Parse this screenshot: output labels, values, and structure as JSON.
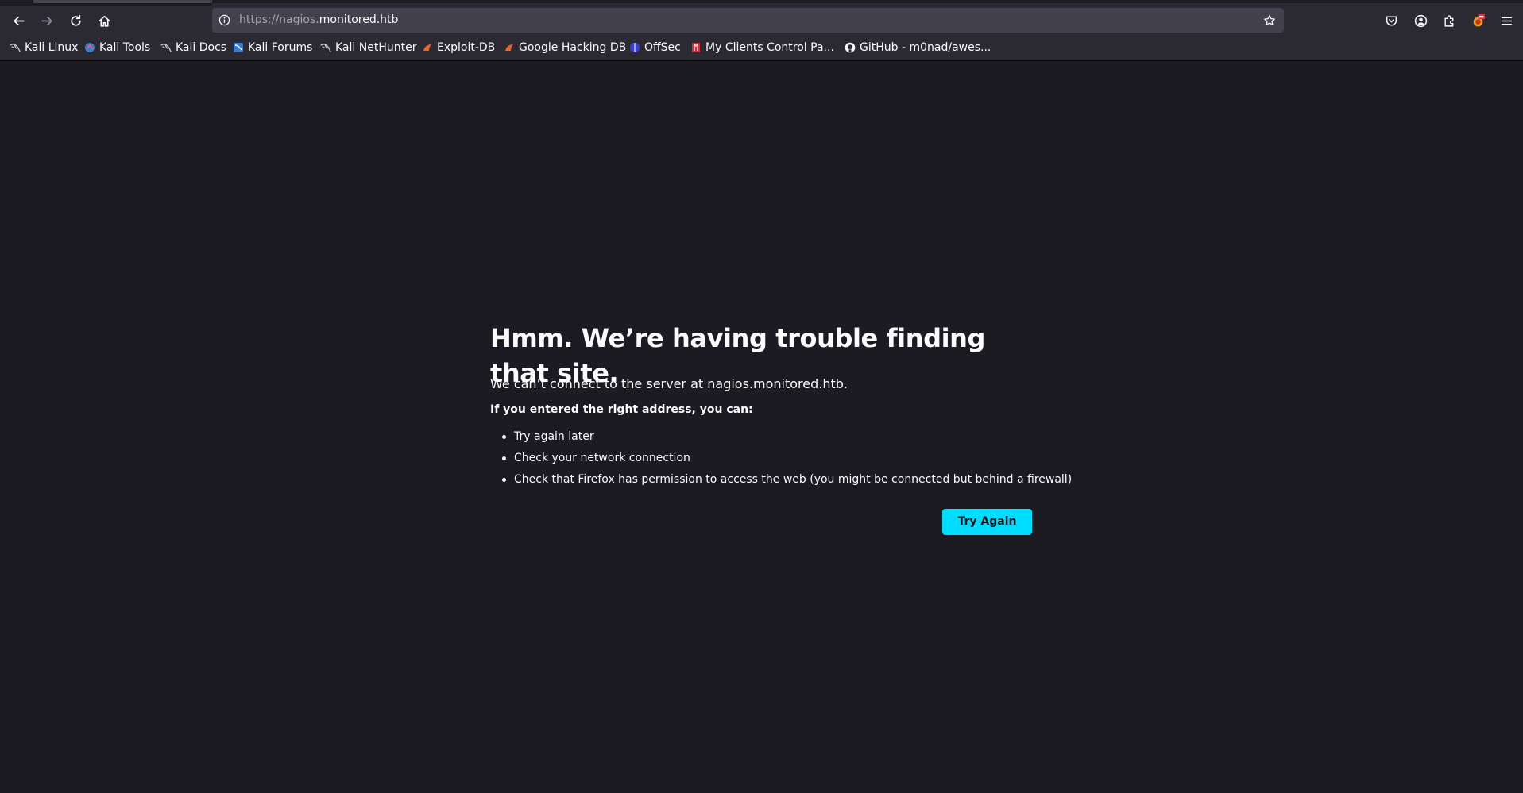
{
  "browser": {
    "url_prefix": "https://nagios.",
    "url_domain": "monitored.htb",
    "icons": {
      "back": "arrow-left",
      "forward": "arrow-right",
      "reload": "reload",
      "home": "home",
      "info": "info-circle",
      "bookmark_star": "star",
      "pocket": "pocket",
      "account": "account",
      "extensions": "puzzle",
      "menu": "hamburger"
    }
  },
  "bookmarks": [
    {
      "label": "Kali Linux",
      "icon": "kali-dragon"
    },
    {
      "label": "Kali Tools",
      "icon": "kali-tools"
    },
    {
      "label": "Kali Docs",
      "icon": "kali-dragon"
    },
    {
      "label": "Kali Forums",
      "icon": "kali-forums"
    },
    {
      "label": "Kali NetHunter",
      "icon": "kali-dragon"
    },
    {
      "label": "Exploit-DB",
      "icon": "exploit-db"
    },
    {
      "label": "Google Hacking DB",
      "icon": "exploit-db"
    },
    {
      "label": "OffSec",
      "icon": "offsec"
    },
    {
      "label": "My Clients Control Pa...",
      "icon": "clients-panel"
    },
    {
      "label": "GitHub - m0nad/awes...",
      "icon": "github"
    }
  ],
  "error": {
    "title": "Hmm. We’re having trouble finding that site.",
    "description": "We can’t connect to the server at nagios.monitored.htb.",
    "suggestion_heading": "If you entered the right address, you can:",
    "suggestions": [
      "Try again later",
      "Check your network connection",
      "Check that Firefox has permission to access the web (you might be connected but behind a firewall)"
    ],
    "try_again_label": "Try Again"
  },
  "colors": {
    "page_bg": "#1c1b22",
    "toolbar_bg": "#2b2a33",
    "urlbar_bg": "#42414d",
    "accent_button": "#00ddff",
    "text": "#fbfbfe"
  }
}
